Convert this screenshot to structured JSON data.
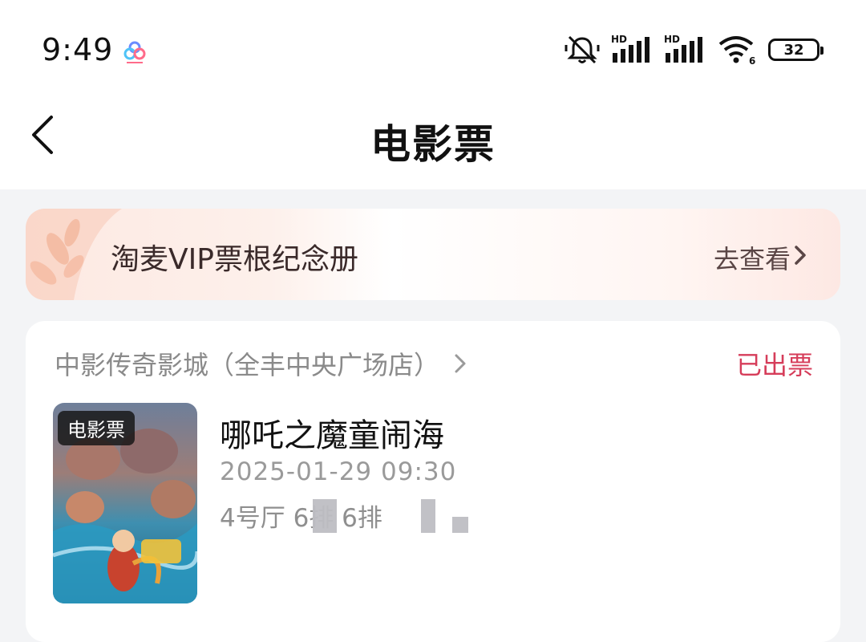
{
  "status_bar": {
    "time": "9:49",
    "hd_label_1": "HD",
    "hd_label_2": "HD",
    "wifi_badge": "6",
    "battery": "32",
    "icons": [
      "app-cloud-icon",
      "mute-bell-icon",
      "signal-icon",
      "signal-icon",
      "wifi-icon",
      "battery-icon"
    ]
  },
  "nav": {
    "title": "电影票",
    "back_icon": "chevron-left-icon"
  },
  "banner": {
    "title": "淘麦VIP票根纪念册",
    "cta": "去查看",
    "cta_icon": "chevron-right-icon"
  },
  "order": {
    "cinema": "中影传奇影城（全丰中央广场店）",
    "status": "已出票",
    "poster_tag": "电影票",
    "movie_title": "哪吒之魔童闹海",
    "datetime": "2025-01-29 09:30",
    "seat": "4号厅 6排 6排"
  },
  "colors": {
    "status_red": "#d63d5a",
    "page_bg": "#f3f4f6",
    "banner_peach": "#fde9e2"
  }
}
